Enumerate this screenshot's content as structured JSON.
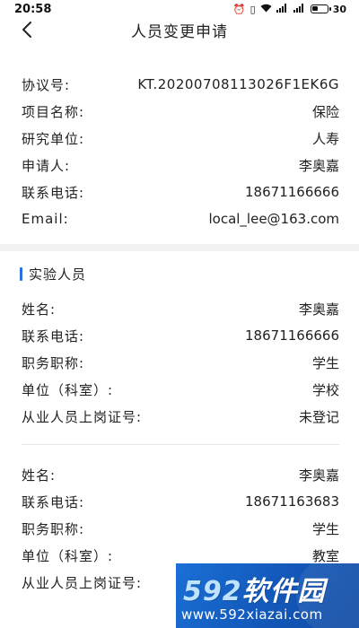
{
  "status": {
    "time": "20:58",
    "battery": "30"
  },
  "header": {
    "title": "人员变更申请"
  },
  "agreement": {
    "rows": [
      {
        "label": "协议号:",
        "value": "KT.20200708113026F1EK6G"
      },
      {
        "label": "项目名称:",
        "value": "保险"
      },
      {
        "label": "研究单位:",
        "value": "人寿"
      },
      {
        "label": "申请人:",
        "value": "李奥嘉"
      },
      {
        "label": "联系电话:",
        "value": "18671166666"
      },
      {
        "label": "Email:",
        "value": "local_lee@163.com"
      }
    ]
  },
  "personnel": {
    "title": "实验人员",
    "people": [
      {
        "rows": [
          {
            "label": "姓名:",
            "value": "李奥嘉"
          },
          {
            "label": "联系电话:",
            "value": "18671166666"
          },
          {
            "label": "职务职称:",
            "value": "学生"
          },
          {
            "label": "单位（科室）:",
            "value": "学校"
          },
          {
            "label": "从业人员上岗证号:",
            "value": "未登记"
          }
        ]
      },
      {
        "rows": [
          {
            "label": "姓名:",
            "value": "李奥嘉"
          },
          {
            "label": "联系电话:",
            "value": "18671163683"
          },
          {
            "label": "职务职称:",
            "value": "学生"
          },
          {
            "label": "单位（科室）:",
            "value": "教室"
          },
          {
            "label": "从业人员上岗证号:",
            "value": ""
          }
        ]
      }
    ]
  },
  "watermark": {
    "logo_num": "592",
    "logo_text": "软件园",
    "url": "www.592xiazai.com"
  },
  "colors": {
    "accent": "#2b6fe0",
    "divider": "#f2f2f2"
  }
}
